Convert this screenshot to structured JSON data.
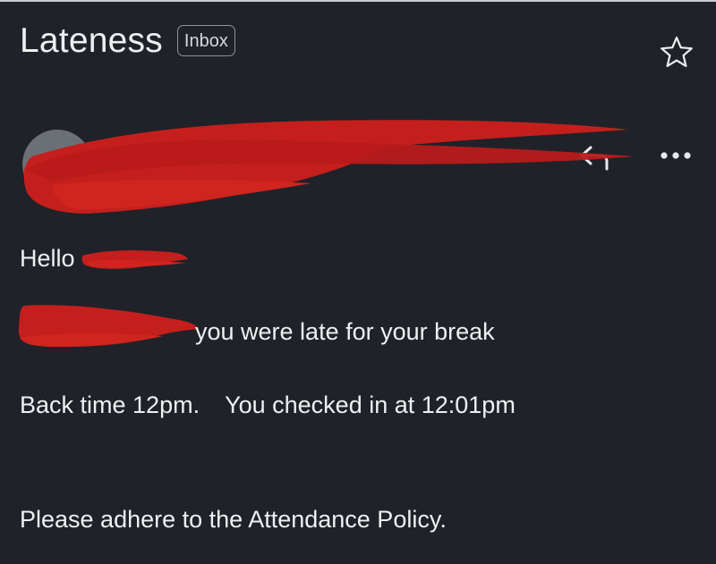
{
  "message": {
    "subject": "Lateness",
    "folder_label": "Inbox",
    "greeting": "Hello",
    "lines": [
      "you were late for your break",
      "Back time 12pm.",
      "You checked in at 12:01pm",
      "Please adhere to the Attendance Policy."
    ]
  },
  "icons": {
    "star": "star-icon",
    "reply": "reply-icon",
    "more": "more-icon"
  },
  "colors": {
    "background": "#1f2228",
    "text": "#eef0f2",
    "redaction": "#c41f1d"
  }
}
